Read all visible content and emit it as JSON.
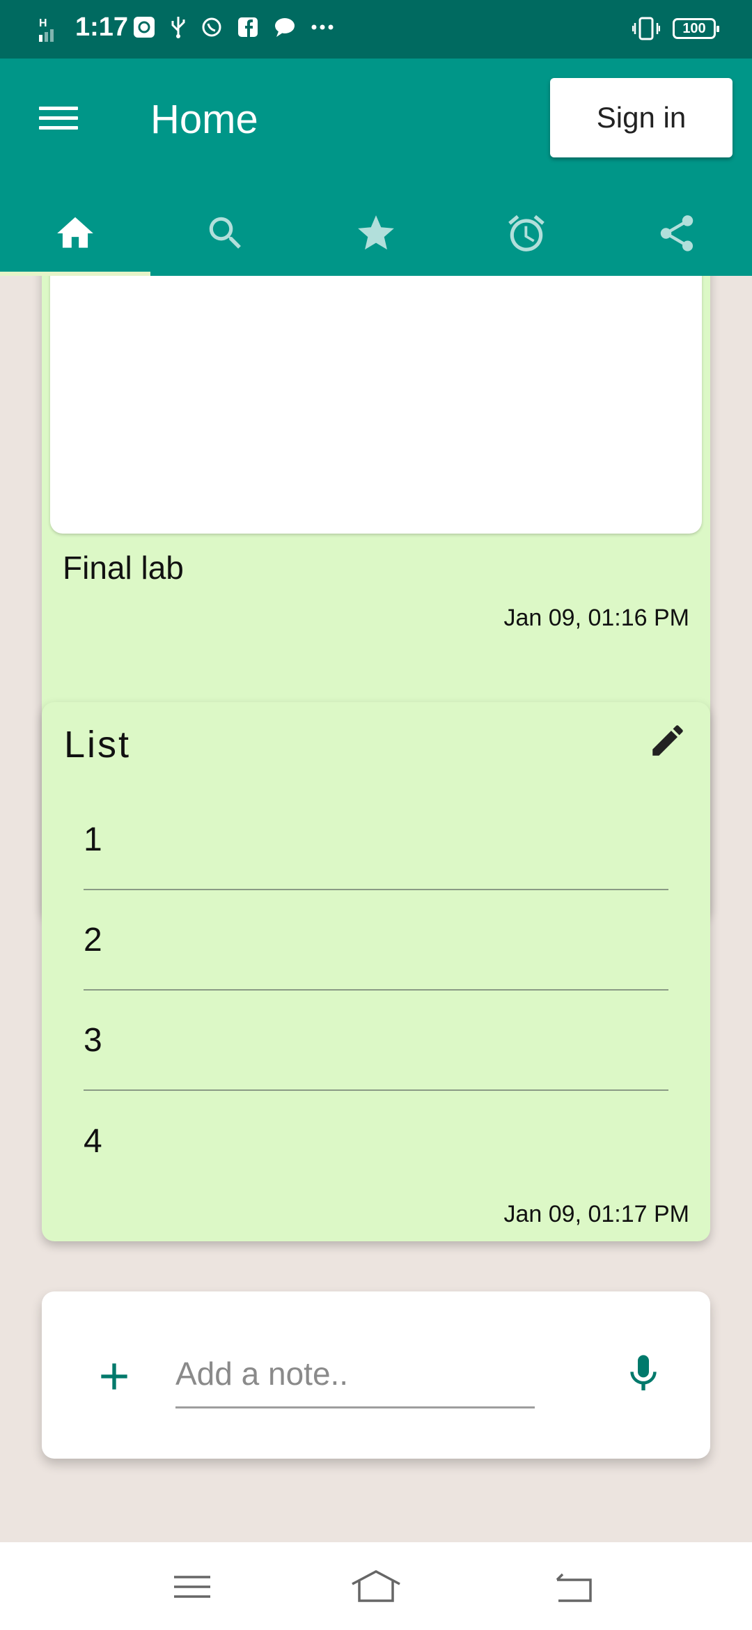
{
  "status_bar": {
    "time": "1:17",
    "network_label": "H",
    "battery": "100"
  },
  "app_bar": {
    "title": "Home",
    "sign_in_label": "Sign in"
  },
  "tabs": [
    {
      "icon": "home-icon",
      "active": true
    },
    {
      "icon": "search-icon",
      "active": false
    },
    {
      "icon": "star-icon",
      "active": false
    },
    {
      "icon": "alarm-icon",
      "active": false
    },
    {
      "icon": "share-icon",
      "active": false
    }
  ],
  "notes": [
    {
      "title": "Final lab",
      "timestamp": "Jan 09, 01:16 PM"
    },
    {
      "title": "List",
      "items": [
        "1",
        "2",
        "3",
        "4"
      ],
      "timestamp": "Jan 09, 01:17 PM"
    }
  ],
  "composer": {
    "placeholder": "Add a note.."
  },
  "colors": {
    "primary": "#009688",
    "status_bar": "#006a60",
    "note_bg": "#dcf8c6",
    "page_bg": "#ece4df",
    "accent_icon": "#00796b"
  }
}
